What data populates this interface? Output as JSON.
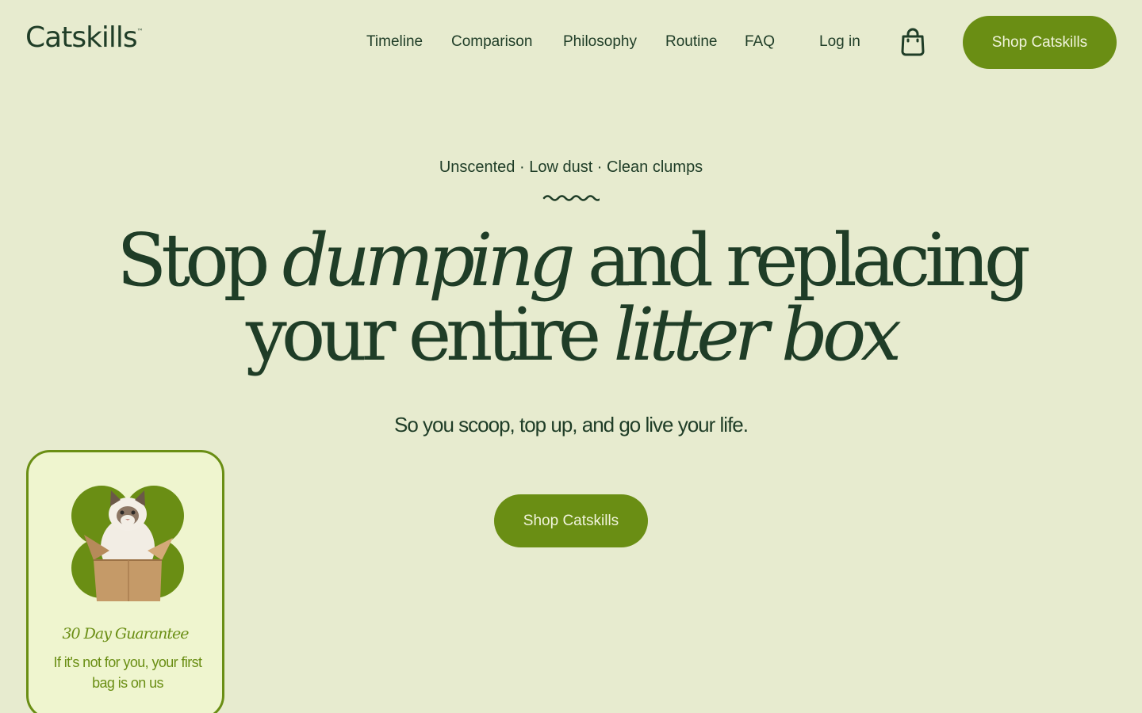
{
  "header": {
    "logo_text": "Catskills",
    "logo_tm": "™",
    "nav": [
      {
        "label": "Timeline"
      },
      {
        "label": "Comparison"
      },
      {
        "label": "Philosophy"
      },
      {
        "label": "Routine"
      },
      {
        "label": "FAQ"
      }
    ],
    "login_label": "Log in",
    "cart_icon": "shopping-bag-icon",
    "shop_label": "Shop Catskills"
  },
  "hero": {
    "eyebrow": "Unscented · Low dust · Clean clumps",
    "headline": {
      "w1": "Stop ",
      "w2": "dumping",
      "w3": " and replacing",
      "w4": "your entire ",
      "w5": "litter box"
    },
    "subhead": "So you scoop, top up, and go live your life.",
    "cta_label": "Shop Catskills"
  },
  "guarantee": {
    "title": "30 Day Guarantee",
    "text": "If it's not for you, your first bag is on us"
  },
  "colors": {
    "background": "#e7ebcf",
    "text_dark": "#1f3d27",
    "accent_green": "#6a8e14",
    "card_bg": "#eff5cf"
  }
}
